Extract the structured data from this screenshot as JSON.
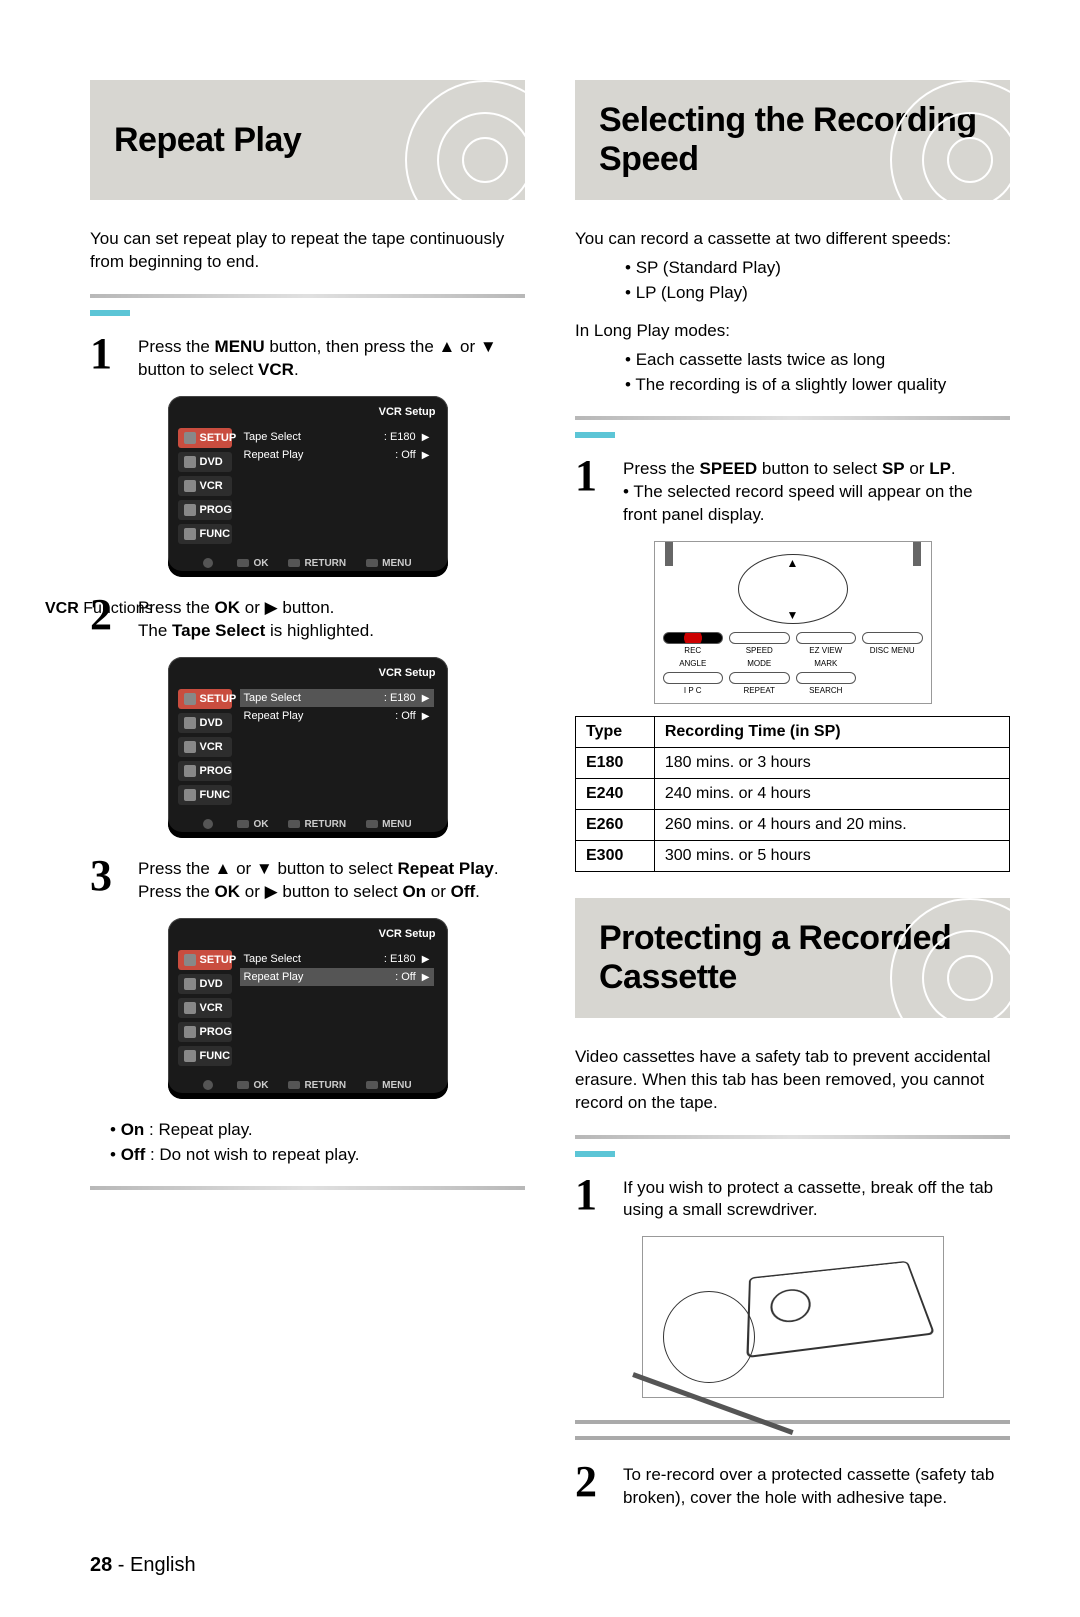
{
  "page": {
    "number": "28",
    "lang": "English"
  },
  "sideTab": {
    "line1": "VCR ",
    "line2": "Functions"
  },
  "left": {
    "title": "Repeat Play",
    "intro": "You can set repeat play to repeat the tape continuously from beginning to end.",
    "step1": {
      "text_a": "Press the ",
      "bold1": "MENU",
      "text_b": " button, then press the ▲ or ▼ button to select ",
      "bold2": "VCR",
      "text_c": "."
    },
    "step2": {
      "text_a": "Press the ",
      "bold1": "OK",
      "text_b": " or ▶ button.",
      "text_c": "The ",
      "bold2": "Tape Select",
      "text_d": " is highlighted."
    },
    "step3": {
      "text_a": "Press the ▲ or ▼ button to select ",
      "bold1": "Repeat Play",
      "text_b": ".",
      "text_c": "Press the ",
      "bold2": "OK",
      "text_d": " or ▶ button to select ",
      "bold3": "On",
      "text_e": " or ",
      "bold4": "Off",
      "text_f": "."
    },
    "legend": {
      "on_label": "On",
      "on_desc": " : Repeat play.",
      "off_label": "Off",
      "off_desc": " : Do not wish to repeat play."
    }
  },
  "right": {
    "title1": "Selecting the Recording Speed",
    "intro1": "You can record a cassette at two different speeds:",
    "speed_list": [
      "SP (Standard Play)",
      "LP (Long Play)"
    ],
    "lp_intro": "In Long Play modes:",
    "lp_list": [
      "Each cassette lasts twice as long",
      "The recording is of a slightly lower quality"
    ],
    "step1_sel": {
      "text_a": "Press the ",
      "bold1": "SPEED",
      "text_b": " button to select ",
      "bold2": "SP",
      "text_c": " or ",
      "bold3": "LP",
      "text_d": ".",
      "text_e": "• The selected record speed will appear on the front panel display."
    },
    "rec_table": {
      "head": [
        "Type",
        "Recording Time (in SP)"
      ],
      "rows": [
        [
          "E180",
          "180 mins. or 3 hours"
        ],
        [
          "E240",
          "240 mins. or 4 hours"
        ],
        [
          "E260",
          "260 mins. or 4 hours and 20 mins."
        ],
        [
          "E300",
          "300 mins. or 5 hours"
        ]
      ]
    },
    "title2": "Protecting a Recorded Cassette",
    "intro2": "Video cassettes have a safety tab to prevent accidental erasure. When this tab has been removed, you cannot record on the tape.",
    "prot_step1": "If you wish to protect a cassette, break off the tab using a small screwdriver.",
    "prot_step2": "To re-record over a protected cassette (safety tab broken), cover the hole with adhesive tape."
  },
  "osd": {
    "title": "VCR Setup",
    "side": [
      "SETUP",
      "DVD",
      "VCR",
      "PROG",
      "FUNC"
    ],
    "rows": [
      {
        "label": "Tape Select",
        "value": ": E180",
        "arrow": "▶"
      },
      {
        "label": "Repeat Play",
        "value": ": Off",
        "arrow": "▶"
      }
    ],
    "foot": {
      "move": "",
      "ok": "OK",
      "ret": "RETURN",
      "menu": "MENU"
    }
  },
  "remote_labels": [
    "REC",
    "SPEED",
    "EZ VIEW",
    "DISC MENU",
    "ANGLE",
    "MODE",
    "MARK",
    "",
    "I P C",
    "REPEAT",
    "SEARCH",
    ""
  ]
}
